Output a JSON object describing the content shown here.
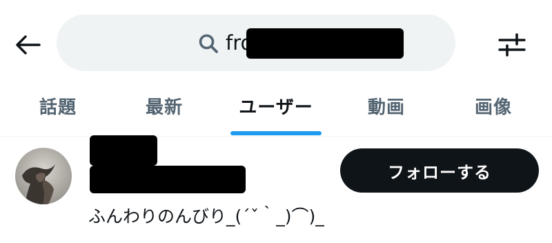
{
  "header": {
    "back_icon": "arrow-left-icon",
    "search": {
      "icon": "search-icon",
      "query": "from:@"
    },
    "filter_icon": "sliders-icon"
  },
  "tabs": [
    {
      "label": "話題",
      "active": false
    },
    {
      "label": "最新",
      "active": false
    },
    {
      "label": "ユーザー",
      "active": true
    },
    {
      "label": "動画",
      "active": false
    },
    {
      "label": "画像",
      "active": false
    }
  ],
  "colors": {
    "accent": "#1d9bf0",
    "text_primary": "#0f1419",
    "text_secondary": "#536471",
    "search_bg": "#eff3f4",
    "button_bg": "#0f1419",
    "button_text": "#ffffff"
  },
  "user_result": {
    "follow_label": "フォローする",
    "bio": "ふんわりのんびり_(´ˇ｀_)⌒)_"
  }
}
